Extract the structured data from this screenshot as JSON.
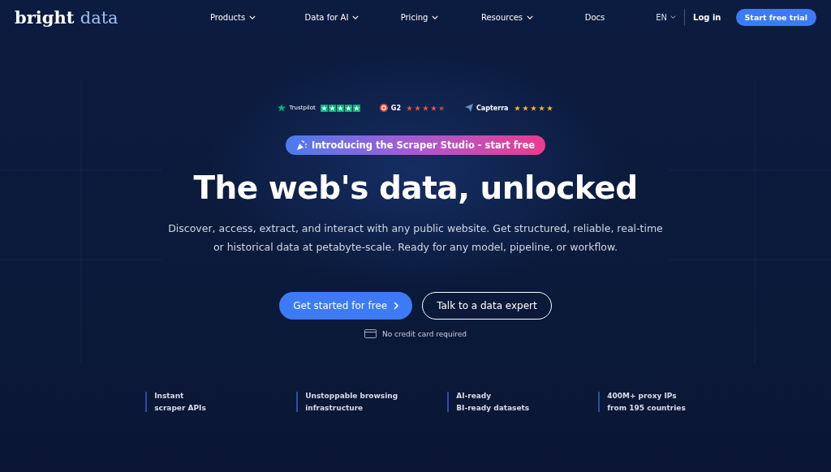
{
  "nav": {
    "logo": [
      "bright",
      "data"
    ],
    "menu": [
      {
        "label": "Products",
        "dropdown": true
      },
      {
        "label": "Data for AI",
        "dropdown": true
      },
      {
        "label": "Pricing",
        "dropdown": true
      },
      {
        "label": "Resources",
        "dropdown": true
      },
      {
        "label": "Docs",
        "dropdown": false
      }
    ],
    "language": "EN",
    "login": "Log in",
    "cta": "Start free trial"
  },
  "ratings": [
    {
      "kind": "trustpilot",
      "name": "Trustpilot",
      "stars": 5
    },
    {
      "kind": "g2",
      "name": "G2",
      "stars": 4.5
    },
    {
      "kind": "capterra",
      "name": "Capterra",
      "stars": 5
    }
  ],
  "announcement": "Introducing the Scraper Studio - start free",
  "headline": "The web's data, unlocked",
  "subheadline": "Discover, access, extract, and interact with any public website. Get structured, reliable, real-time or historical data at petabyte-scale. Ready for any model, pipeline, or workflow.",
  "primary_button": "Get started for free",
  "secondary_button": "Talk to a data expert",
  "note": "No credit card required",
  "features": [
    [
      "Instant",
      "scraper APIs"
    ],
    [
      "Unstoppable browsing",
      "infrastructure"
    ],
    [
      "AI-ready",
      "BI-ready datasets"
    ],
    [
      "400M+ proxy IPs",
      "from 195 countries"
    ]
  ]
}
